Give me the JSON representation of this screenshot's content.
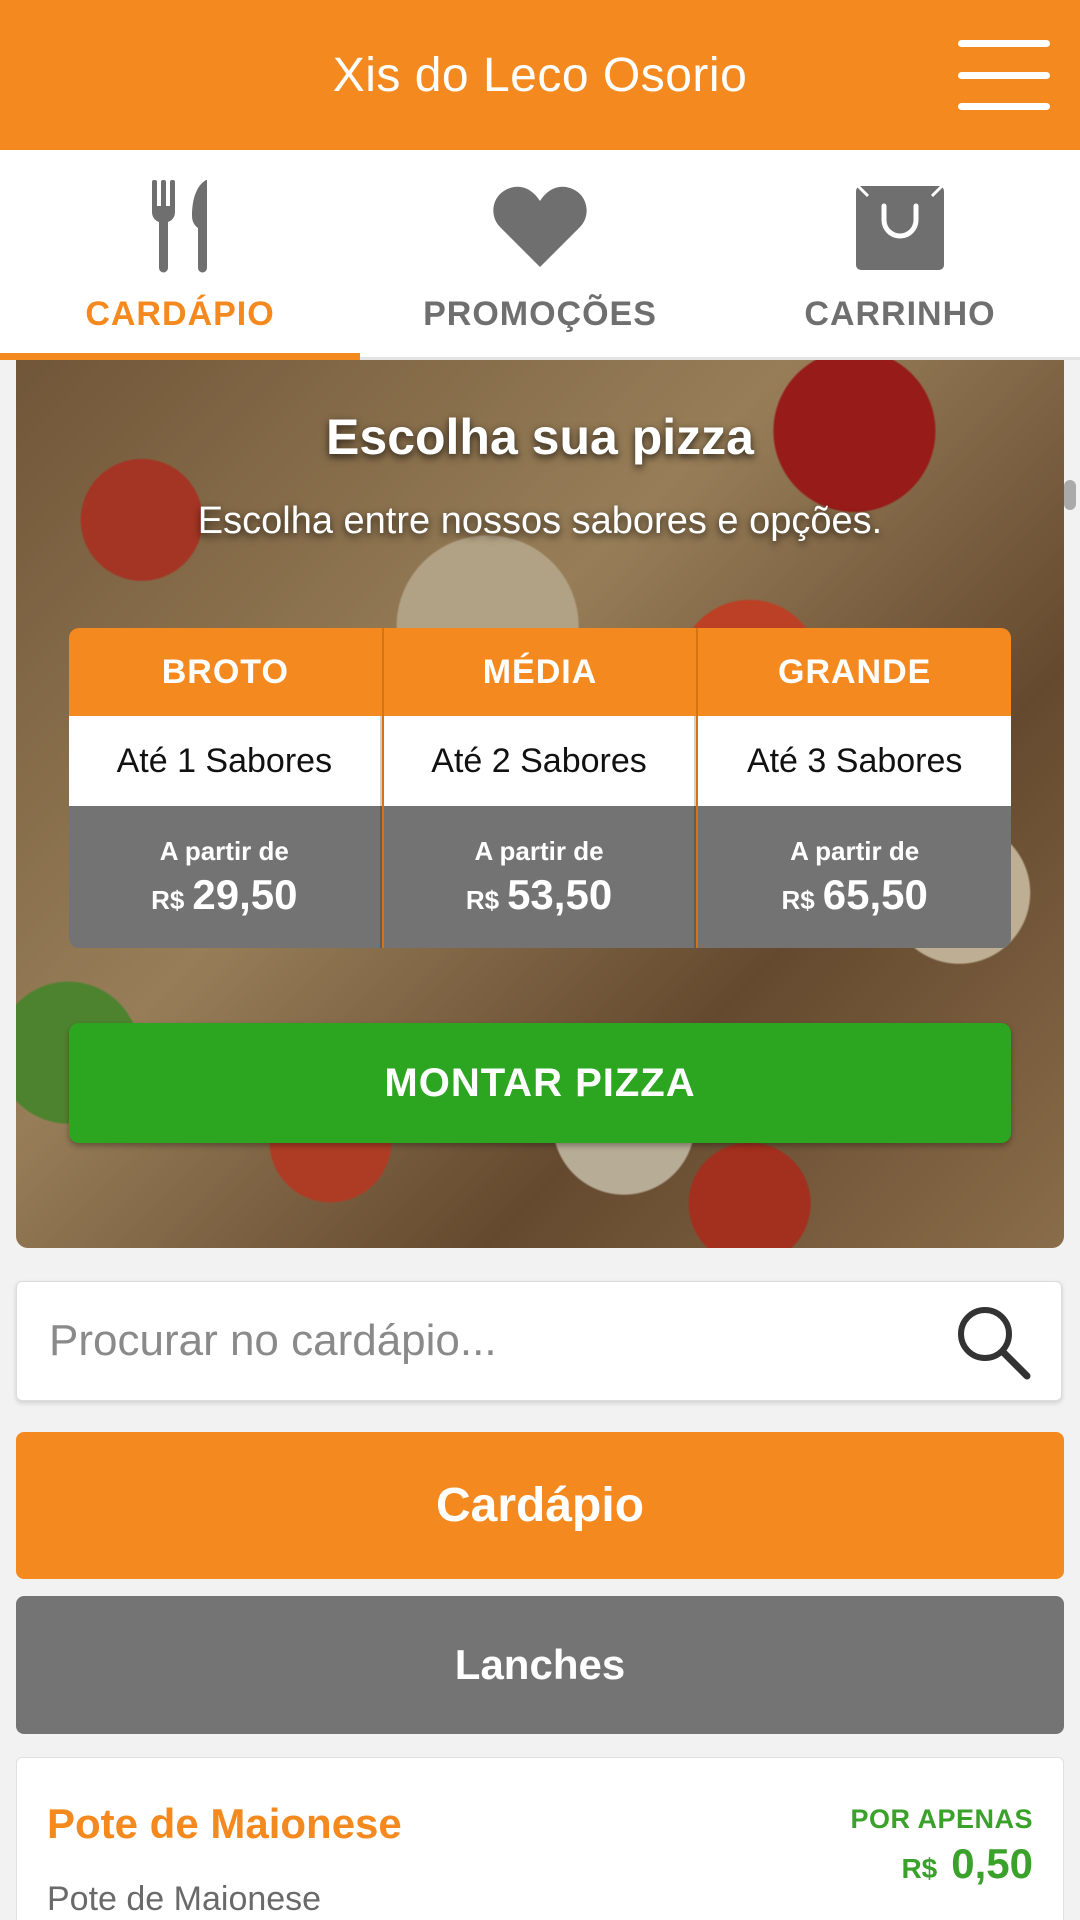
{
  "header": {
    "title": "Xis do Leco Osorio",
    "menu_icon": "hamburger-menu-icon"
  },
  "tabs": [
    {
      "label": "CARDÁPIO",
      "icon": "fork-knife-icon",
      "active": true
    },
    {
      "label": "PROMOÇÕES",
      "icon": "heart-icon",
      "active": false
    },
    {
      "label": "CARRINHO",
      "icon": "shopping-bag-icon",
      "active": false
    }
  ],
  "hero": {
    "title": "Escolha sua pizza",
    "subtitle": "Escolha entre nossos sabores e opções.",
    "sizes": [
      {
        "name": "BROTO",
        "flavors": "Até 1 Sabores",
        "price_from": "A partir de",
        "currency": "R$",
        "price": "29,50"
      },
      {
        "name": "MÉDIA",
        "flavors": "Até 2 Sabores",
        "price_from": "A partir de",
        "currency": "R$",
        "price": "53,50"
      },
      {
        "name": "GRANDE",
        "flavors": "Até 3 Sabores",
        "price_from": "A partir de",
        "currency": "R$",
        "price": "65,50"
      }
    ],
    "button_label": "MONTAR PIZZA"
  },
  "search": {
    "placeholder": "Procurar no cardápio..."
  },
  "categories": {
    "main": "Cardápio",
    "sub": "Lanches"
  },
  "product": {
    "name": "Pote de Maionese",
    "description": "Pote de Maionese",
    "tag": "POR APENAS",
    "currency": "R$",
    "price": "0,50"
  },
  "colors": {
    "brand_orange": "#f48a1f",
    "action_green": "#2ca521",
    "gray": "#747474",
    "price_green": "#3aa12a"
  }
}
